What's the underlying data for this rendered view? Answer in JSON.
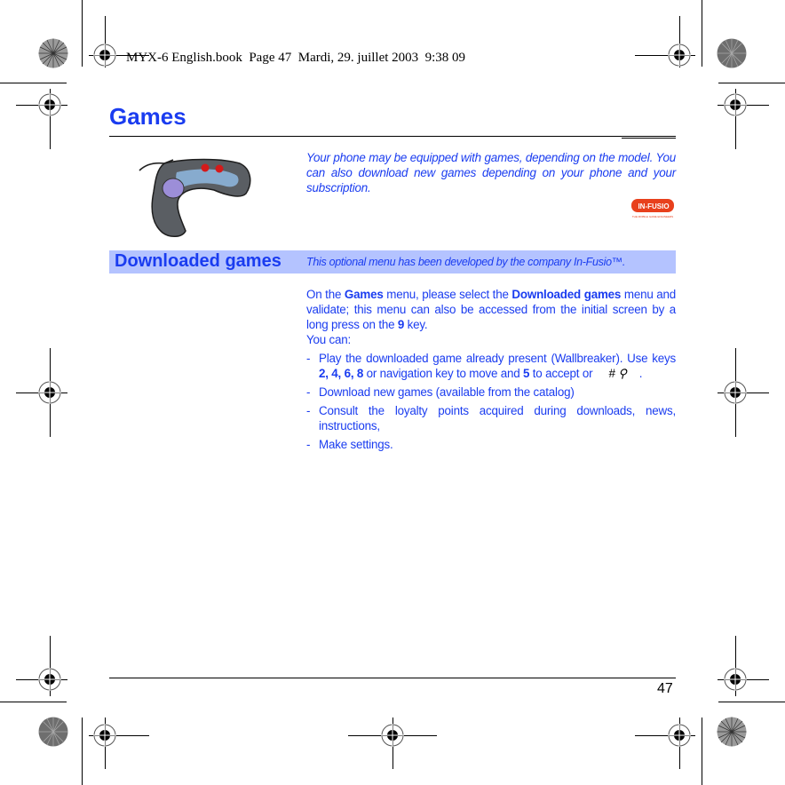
{
  "header_stamp": "MYX-6 English.book  Page 47  Mardi, 29. juillet 2003  9:38 09",
  "section": {
    "title": "Games",
    "intro": "Your phone may be equipped with games, depending on the model. You can also download new games depending on your phone and your subscription.",
    "logo_text": "IN-FUSIO",
    "logo_tagline": "THE MOBILE GAME ENGINEERS"
  },
  "subsection": {
    "title": "Downloaded games",
    "note": "This optional menu has been developed by the company In-Fusio™."
  },
  "body": {
    "para_parts": [
      "On the ",
      "Games",
      " menu, please select the ",
      "Downloaded games",
      " menu and validate; this menu can also be accessed from the initial screen by a long press on the ",
      "9",
      " key."
    ],
    "you_can": "You can:",
    "bullets": [
      {
        "text_a": "Play the downloaded game already present (Wallbreaker). Use keys ",
        "keys_move": "2, 4, 6, 8",
        "text_b": " or navigation key to move and ",
        "key_accept": "5",
        "text_c": " to accept or",
        "keys_glyph": "# ⚲",
        "text_d": "."
      },
      {
        "text": "Download new games (available from the catalog)"
      },
      {
        "text": "Consult the loyalty points acquired during downloads, news, instructions,"
      },
      {
        "text": "Make settings."
      }
    ],
    "dash": "-"
  },
  "footer": {
    "page_number": "47"
  },
  "colors": {
    "accent_blue": "#1a3cf0",
    "banner_bg": "#b4c3ff",
    "logo_red": "#e8401c"
  }
}
